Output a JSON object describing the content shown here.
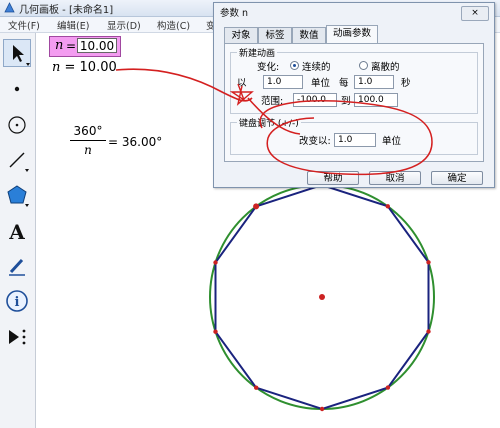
{
  "window": {
    "title": "几何画板 - [未命名1]"
  },
  "menu": [
    {
      "label": "文件(F)"
    },
    {
      "label": "编辑(E)"
    },
    {
      "label": "显示(D)"
    },
    {
      "label": "构造(C)"
    },
    {
      "label": "变换(T"
    }
  ],
  "toolbox": {
    "text_tool_glyph": "A",
    "info_tool_glyph": "i"
  },
  "parameter": {
    "name": "n",
    "equals": "=",
    "value": "10.00"
  },
  "measurement": {
    "name": "n",
    "text": " = 10.00"
  },
  "calculation": {
    "numerator": "360°",
    "denominator": "n",
    "result": "= 36.00°"
  },
  "dialog": {
    "title": "参数 n",
    "close_label": "×",
    "tabs": [
      {
        "label": "对象"
      },
      {
        "label": "标签"
      },
      {
        "label": "数值"
      },
      {
        "label": "动画参数",
        "active": true
      }
    ],
    "new_animation": {
      "group_title": "新建动画",
      "change_label": "变化:",
      "continuous_label": "连续的",
      "discrete_label": "离散的",
      "selected": "连续的",
      "rate_prefix": "以",
      "rate_value": "1.0",
      "unit_label": "单位",
      "every_label": "每",
      "every_value": "1.0",
      "second_label": "秒",
      "range_label": "范围:",
      "range_from": "-100.0",
      "to_label": "到",
      "range_to": "100.0"
    },
    "keyboard_adjust": {
      "group_title": "键盘调节 (+/-)",
      "change_by_label": "改变以:",
      "change_by_value": "1.0",
      "unit_label": "单位"
    },
    "buttons": {
      "help": "帮助",
      "cancel": "取消",
      "ok": "确定"
    }
  },
  "figure": {
    "polygon_sides": 10
  },
  "colors": {
    "circle": "#2f8f2f",
    "polygon": "#1a237e",
    "points": "#cc2222",
    "annotation": "#d42020",
    "parameter_fill": "#f39cf0"
  }
}
